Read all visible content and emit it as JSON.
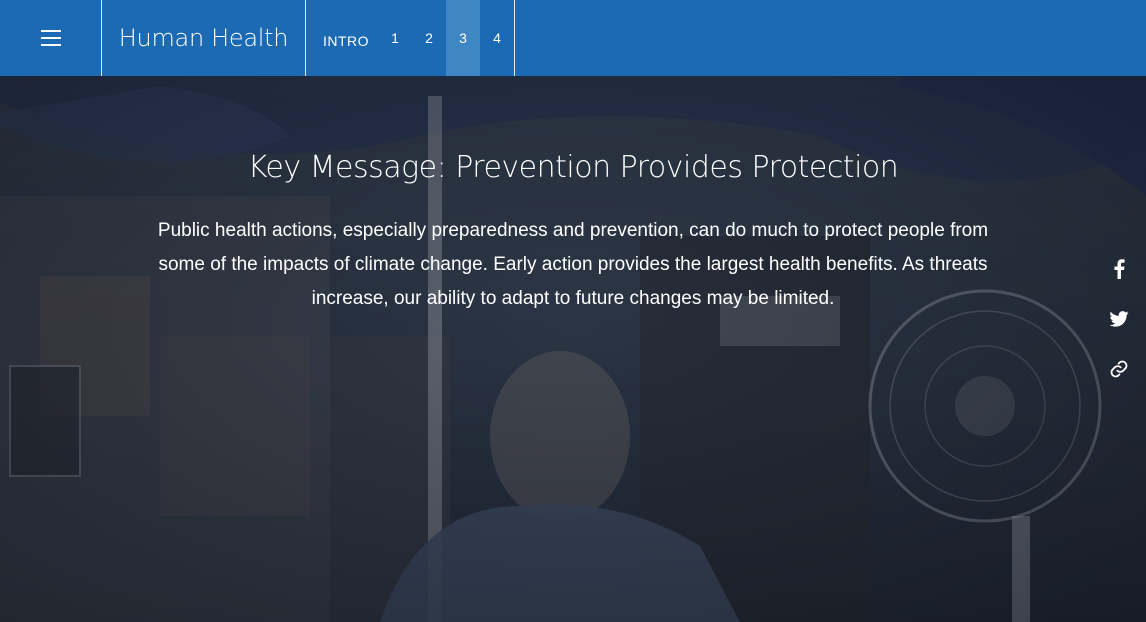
{
  "header": {
    "menu_icon": "hamburger-menu-icon",
    "title": "Human Health",
    "nav": {
      "intro": "INTRO",
      "items": [
        "1",
        "2",
        "3",
        "4"
      ],
      "active": "3"
    }
  },
  "hero": {
    "headline": "Key Message: Prevention Provides Protection",
    "body": "Public health actions, especially preparedness and prevention, can do much to protect people from some of the impacts of climate change. Early action provides the largest health benefits. As threats increase, our ability to adapt to future changes may be limited."
  },
  "share": {
    "icons": [
      "facebook-icon",
      "twitter-icon",
      "link-icon"
    ]
  },
  "colors": {
    "nav_bg": "#1b6ab3",
    "nav_active": "#3f86c4",
    "overlay": "#1f2a3c"
  }
}
